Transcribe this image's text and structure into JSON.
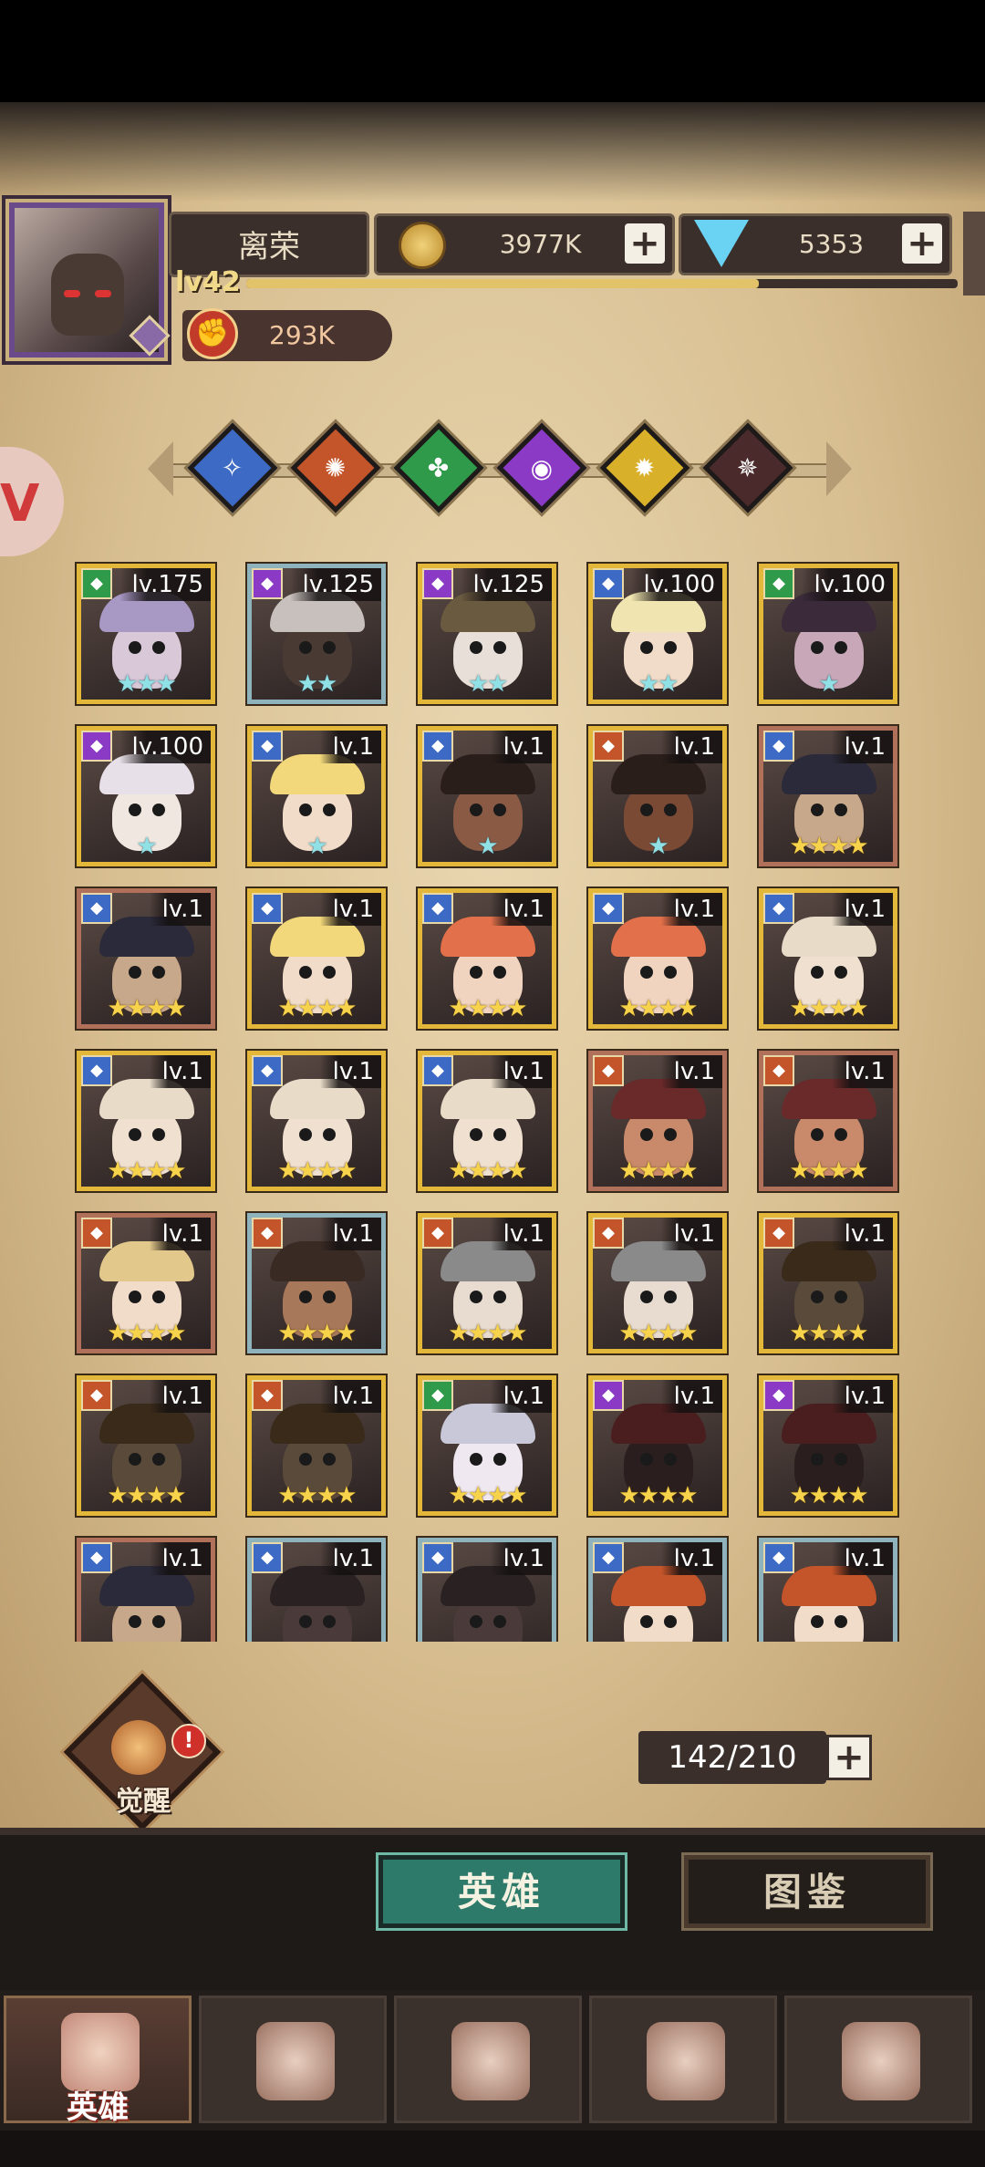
{
  "player": {
    "name": "离荣",
    "level": "lv42",
    "exp_fraction": 0.72,
    "power": "293K"
  },
  "resources": {
    "gold": "3977K",
    "gems": "5353",
    "plus": "+"
  },
  "filters": [
    {
      "icon": "faction-light-icon",
      "color": "#3d6ac4",
      "glyph": "✧"
    },
    {
      "icon": "faction-fire-icon",
      "color": "#c4552a",
      "glyph": "✺"
    },
    {
      "icon": "faction-nature-icon",
      "color": "#2f9a4a",
      "glyph": "✤"
    },
    {
      "icon": "faction-arcane-icon",
      "color": "#8a3ac4",
      "glyph": "◉"
    },
    {
      "icon": "faction-sun-icon",
      "color": "#d8b02a",
      "glyph": "✹"
    },
    {
      "icon": "faction-dark-icon",
      "color": "#4a2a2a",
      "glyph": "✵"
    }
  ],
  "heroes": [
    {
      "level": "lv.175",
      "stars": 3,
      "star_color": "teal",
      "frame": "gold",
      "class_color": "#2f9a4a",
      "hair": "#a898c4",
      "skin": "#d8c8d8"
    },
    {
      "level": "lv.125",
      "stars": 2,
      "star_color": "teal",
      "frame": "blue",
      "class_color": "#8a3ac4",
      "hair": "#c8c0bc",
      "skin": "#4a3a34"
    },
    {
      "level": "lv.125",
      "stars": 2,
      "star_color": "teal",
      "frame": "gold",
      "class_color": "#8a3ac4",
      "hair": "#6a5a40",
      "skin": "#e8e0d8"
    },
    {
      "level": "lv.100",
      "stars": 2,
      "star_color": "teal",
      "frame": "gold",
      "class_color": "#3d6ac4",
      "hair": "#f0e4b0",
      "skin": "#f0dcc8"
    },
    {
      "level": "lv.100",
      "stars": 1,
      "star_color": "teal",
      "frame": "gold",
      "class_color": "#2f9a4a",
      "hair": "#3a2a3a",
      "skin": "#c8a8b8"
    },
    {
      "level": "lv.100",
      "stars": 1,
      "star_color": "teal",
      "frame": "gold",
      "class_color": "#8a3ac4",
      "hair": "#e8e0e8",
      "skin": "#f0e8e0"
    },
    {
      "level": "lv.1",
      "stars": 1,
      "star_color": "teal",
      "frame": "gold",
      "class_color": "#3d6ac4",
      "hair": "#f2d87a",
      "skin": "#f0dcc8"
    },
    {
      "level": "lv.1",
      "stars": 1,
      "star_color": "teal",
      "frame": "gold",
      "class_color": "#3d6ac4",
      "hair": "#2a1e1a",
      "skin": "#8a5a44"
    },
    {
      "level": "lv.1",
      "stars": 1,
      "star_color": "teal",
      "frame": "gold",
      "class_color": "#c4552a",
      "hair": "#2a1e1a",
      "skin": "#7a4a34"
    },
    {
      "level": "lv.1",
      "stars": 4,
      "star_color": "gold",
      "frame": "red",
      "class_color": "#3d6ac4",
      "hair": "#2a2a3a",
      "skin": "#c8a88a"
    },
    {
      "level": "lv.1",
      "stars": 4,
      "star_color": "gold",
      "frame": "red",
      "class_color": "#3d6ac4",
      "hair": "#2a2a3a",
      "skin": "#c8a88a"
    },
    {
      "level": "lv.1",
      "stars": 4,
      "star_color": "gold",
      "frame": "gold",
      "class_color": "#3d6ac4",
      "hair": "#f2d87a",
      "skin": "#f0dcc8"
    },
    {
      "level": "lv.1",
      "stars": 4,
      "star_color": "gold",
      "frame": "gold",
      "class_color": "#3d6ac4",
      "hair": "#e2704a",
      "skin": "#f0d4c0"
    },
    {
      "level": "lv.1",
      "stars": 4,
      "star_color": "gold",
      "frame": "gold",
      "class_color": "#3d6ac4",
      "hair": "#e2704a",
      "skin": "#f0d4c0"
    },
    {
      "level": "lv.1",
      "stars": 4,
      "star_color": "gold",
      "frame": "gold",
      "class_color": "#3d6ac4",
      "hair": "#e8dcc8",
      "skin": "#f0e0d0"
    },
    {
      "level": "lv.1",
      "stars": 4,
      "star_color": "gold",
      "frame": "gold",
      "class_color": "#3d6ac4",
      "hair": "#e8dcc8",
      "skin": "#f0e0d0"
    },
    {
      "level": "lv.1",
      "stars": 4,
      "star_color": "gold",
      "frame": "gold",
      "class_color": "#3d6ac4",
      "hair": "#e8dcc8",
      "skin": "#f0e0d0"
    },
    {
      "level": "lv.1",
      "stars": 4,
      "star_color": "gold",
      "frame": "gold",
      "class_color": "#3d6ac4",
      "hair": "#e8dcc8",
      "skin": "#f0e0d0"
    },
    {
      "level": "lv.1",
      "stars": 4,
      "star_color": "gold",
      "frame": "red",
      "class_color": "#c4552a",
      "hair": "#6a2a2a",
      "skin": "#c88a6a"
    },
    {
      "level": "lv.1",
      "stars": 4,
      "star_color": "gold",
      "frame": "red",
      "class_color": "#c4552a",
      "hair": "#6a2a2a",
      "skin": "#c88a6a"
    },
    {
      "level": "lv.1",
      "stars": 4,
      "star_color": "gold",
      "frame": "red",
      "class_color": "#c4552a",
      "hair": "#e2c88a",
      "skin": "#f0dcc8"
    },
    {
      "level": "lv.1",
      "stars": 4,
      "star_color": "gold",
      "frame": "blue",
      "class_color": "#c4552a",
      "hair": "#3a2a24",
      "skin": "#a8785a"
    },
    {
      "level": "lv.1",
      "stars": 4,
      "star_color": "gold",
      "frame": "gold",
      "class_color": "#c4552a",
      "hair": "#8a8a8a",
      "skin": "#e8dcd0"
    },
    {
      "level": "lv.1",
      "stars": 4,
      "star_color": "gold",
      "frame": "gold",
      "class_color": "#c4552a",
      "hair": "#8a8a8a",
      "skin": "#e8dcd0"
    },
    {
      "level": "lv.1",
      "stars": 4,
      "star_color": "gold",
      "frame": "gold",
      "class_color": "#c4552a",
      "hair": "#3a2a1a",
      "skin": "#5a4a3a"
    },
    {
      "level": "lv.1",
      "stars": 4,
      "star_color": "gold",
      "frame": "gold",
      "class_color": "#c4552a",
      "hair": "#3a2a1a",
      "skin": "#5a4a3a"
    },
    {
      "level": "lv.1",
      "stars": 4,
      "star_color": "gold",
      "frame": "gold",
      "class_color": "#c4552a",
      "hair": "#3a2a1a",
      "skin": "#5a4a3a"
    },
    {
      "level": "lv.1",
      "stars": 4,
      "star_color": "gold",
      "frame": "gold",
      "class_color": "#2f9a4a",
      "hair": "#c8c8d8",
      "skin": "#f0e8f0"
    },
    {
      "level": "lv.1",
      "stars": 4,
      "star_color": "gold",
      "frame": "gold",
      "class_color": "#8a3ac4",
      "hair": "#4a1e1e",
      "skin": "#2a1e1e"
    },
    {
      "level": "lv.1",
      "stars": 4,
      "star_color": "gold",
      "frame": "gold",
      "class_color": "#8a3ac4",
      "hair": "#4a1e1e",
      "skin": "#2a1e1e"
    },
    {
      "level": "lv.1",
      "stars": 0,
      "star_color": "gold",
      "frame": "red",
      "class_color": "#3d6ac4",
      "hair": "#2a2a3a",
      "skin": "#c8a88a"
    },
    {
      "level": "lv.1",
      "stars": 0,
      "star_color": "gold",
      "frame": "blue",
      "class_color": "#3d6ac4",
      "hair": "#2a2222",
      "skin": "#4a3a3a"
    },
    {
      "level": "lv.1",
      "stars": 0,
      "star_color": "gold",
      "frame": "blue",
      "class_color": "#3d6ac4",
      "hair": "#2a2222",
      "skin": "#4a3a3a"
    },
    {
      "level": "lv.1",
      "stars": 0,
      "star_color": "gold",
      "frame": "blue",
      "class_color": "#3d6ac4",
      "hair": "#c4552a",
      "skin": "#f0dcc8"
    },
    {
      "level": "lv.1",
      "stars": 0,
      "star_color": "gold",
      "frame": "blue",
      "class_color": "#3d6ac4",
      "hair": "#c4552a",
      "skin": "#f0dcc8"
    }
  ],
  "awaken": {
    "label": "觉醒",
    "alert": "!"
  },
  "roster": {
    "count": "142/210",
    "plus": "+"
  },
  "segments": {
    "heroes": "英雄",
    "codex": "图鉴"
  },
  "nav": [
    {
      "label": "英雄",
      "icon": "hero-helmet-icon",
      "active": true
    },
    {
      "label": "",
      "icon": "guild-banner-icon",
      "active": false
    },
    {
      "label": "",
      "icon": "battle-swords-icon",
      "active": false
    },
    {
      "label": "",
      "icon": "castle-tower-icon",
      "active": false
    },
    {
      "label": "",
      "icon": "alliance-handshake-icon",
      "active": false
    }
  ]
}
